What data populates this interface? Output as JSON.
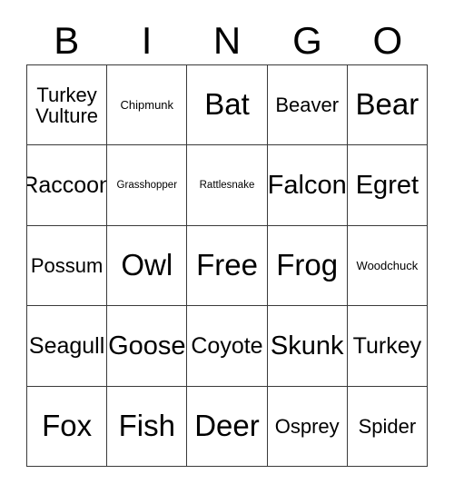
{
  "card": {
    "title_letters": [
      "B",
      "I",
      "N",
      "G",
      "O"
    ],
    "grid": {
      "rows": 5,
      "columns": 5,
      "border_color": "#3a3a3a",
      "background_color": "#ffffff",
      "text_color": "#000000"
    },
    "cells": [
      [
        {
          "text": "Turkey\nVulture",
          "size": "m"
        },
        {
          "text": "Chipmunk",
          "size": "xs"
        },
        {
          "text": "Bat",
          "size": "xxl"
        },
        {
          "text": "Beaver",
          "size": "m"
        },
        {
          "text": "Bear",
          "size": "xxl"
        }
      ],
      [
        {
          "text": "Raccoon",
          "size": "l"
        },
        {
          "text": "Grasshopper",
          "size": "xxs"
        },
        {
          "text": "Rattlesnake",
          "size": "xxs"
        },
        {
          "text": "Falcon",
          "size": "xl"
        },
        {
          "text": "Egret",
          "size": "xl"
        }
      ],
      [
        {
          "text": "Possum",
          "size": "m"
        },
        {
          "text": "Owl",
          "size": "xxl"
        },
        {
          "text": "Free",
          "size": "xxl"
        },
        {
          "text": "Frog",
          "size": "xxl"
        },
        {
          "text": "Woodchuck",
          "size": "xs"
        }
      ],
      [
        {
          "text": "Seagull",
          "size": "l"
        },
        {
          "text": "Goose",
          "size": "xl"
        },
        {
          "text": "Coyote",
          "size": "l"
        },
        {
          "text": "Skunk",
          "size": "xl"
        },
        {
          "text": "Turkey",
          "size": "l"
        }
      ],
      [
        {
          "text": "Fox",
          "size": "xxl"
        },
        {
          "text": "Fish",
          "size": "xxl"
        },
        {
          "text": "Deer",
          "size": "xxl"
        },
        {
          "text": "Osprey",
          "size": "m"
        },
        {
          "text": "Spider",
          "size": "m"
        }
      ]
    ]
  }
}
